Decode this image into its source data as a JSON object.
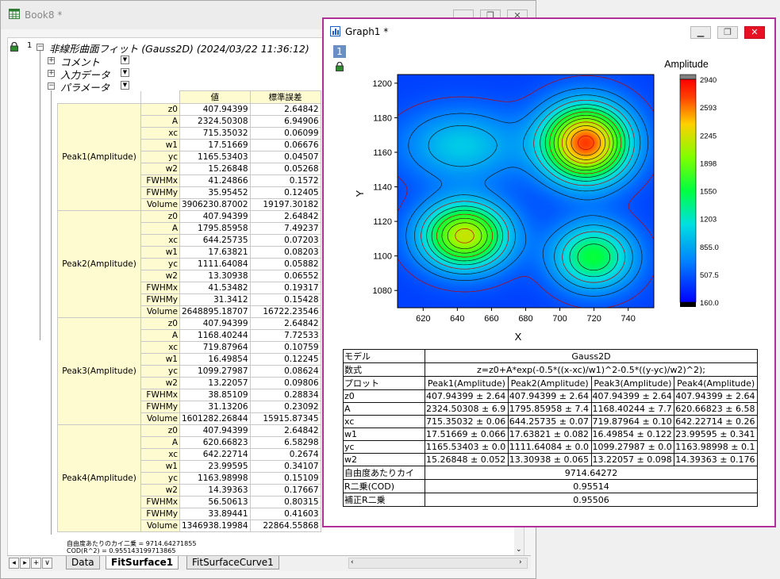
{
  "book": {
    "title": "Book8 *",
    "report_title": "非線形曲面フィット (Gauss2D) (2024/03/22 11:36:12)",
    "sections": [
      "コメント",
      "入力データ",
      "パラメータ"
    ],
    "header": {
      "value": "値",
      "error": "標準誤差"
    },
    "peaks": [
      {
        "label": "Peak1(Amplitude)",
        "rows": [
          {
            "name": "z0",
            "value": "407.94399",
            "error": "2.64842"
          },
          {
            "name": "A",
            "value": "2324.50308",
            "error": "6.94906"
          },
          {
            "name": "xc",
            "value": "715.35032",
            "error": "0.06099"
          },
          {
            "name": "w1",
            "value": "17.51669",
            "error": "0.06676"
          },
          {
            "name": "yc",
            "value": "1165.53403",
            "error": "0.04507"
          },
          {
            "name": "w2",
            "value": "15.26848",
            "error": "0.05268"
          },
          {
            "name": "FWHMx",
            "value": "41.24866",
            "error": "0.1572"
          },
          {
            "name": "FWHMy",
            "value": "35.95452",
            "error": "0.12405"
          },
          {
            "name": "Volume",
            "value": "3906230.87002",
            "error": "19197.30182"
          }
        ]
      },
      {
        "label": "Peak2(Amplitude)",
        "rows": [
          {
            "name": "z0",
            "value": "407.94399",
            "error": "2.64842"
          },
          {
            "name": "A",
            "value": "1795.85958",
            "error": "7.49237"
          },
          {
            "name": "xc",
            "value": "644.25735",
            "error": "0.07203"
          },
          {
            "name": "w1",
            "value": "17.63821",
            "error": "0.08203"
          },
          {
            "name": "yc",
            "value": "1111.64084",
            "error": "0.05882"
          },
          {
            "name": "w2",
            "value": "13.30938",
            "error": "0.06552"
          },
          {
            "name": "FWHMx",
            "value": "41.53482",
            "error": "0.19317"
          },
          {
            "name": "FWHMy",
            "value": "31.3412",
            "error": "0.15428"
          },
          {
            "name": "Volume",
            "value": "2648895.18707",
            "error": "16722.23546"
          }
        ]
      },
      {
        "label": "Peak3(Amplitude)",
        "rows": [
          {
            "name": "z0",
            "value": "407.94399",
            "error": "2.64842"
          },
          {
            "name": "A",
            "value": "1168.40244",
            "error": "7.72533"
          },
          {
            "name": "xc",
            "value": "719.87964",
            "error": "0.10759"
          },
          {
            "name": "w1",
            "value": "16.49854",
            "error": "0.12245"
          },
          {
            "name": "yc",
            "value": "1099.27987",
            "error": "0.08624"
          },
          {
            "name": "w2",
            "value": "13.22057",
            "error": "0.09806"
          },
          {
            "name": "FWHMx",
            "value": "38.85109",
            "error": "0.28834"
          },
          {
            "name": "FWHMy",
            "value": "31.13206",
            "error": "0.23092"
          },
          {
            "name": "Volume",
            "value": "1601282.26844",
            "error": "15915.87345"
          }
        ]
      },
      {
        "label": "Peak4(Amplitude)",
        "rows": [
          {
            "name": "z0",
            "value": "407.94399",
            "error": "2.64842"
          },
          {
            "name": "A",
            "value": "620.66823",
            "error": "6.58298"
          },
          {
            "name": "xc",
            "value": "642.22714",
            "error": "0.2674"
          },
          {
            "name": "w1",
            "value": "23.99595",
            "error": "0.34107"
          },
          {
            "name": "yc",
            "value": "1163.98998",
            "error": "0.15109"
          },
          {
            "name": "w2",
            "value": "14.39363",
            "error": "0.17667"
          },
          {
            "name": "FWHMx",
            "value": "56.50613",
            "error": "0.80315"
          },
          {
            "name": "FWHMy",
            "value": "33.89441",
            "error": "0.41603"
          },
          {
            "name": "Volume",
            "value": "1346938.19984",
            "error": "22864.55868"
          }
        ]
      }
    ],
    "footnote1": "自由度あたりのカイ二乗 = 9714.64271855",
    "footnote2": "COD(R^2) = 0.955143199713865",
    "tabs": [
      "Data",
      "FitSurface1",
      "FitSurfaceCurve1"
    ],
    "row_number": "1"
  },
  "graph": {
    "title": "Graph1 *",
    "layer_number": "1",
    "colorbar_title": "Amplitude",
    "colorbar_ticks": [
      "2940",
      "2593",
      "2245",
      "1898",
      "1550",
      "1203",
      "855.0",
      "507.5",
      "160.0"
    ],
    "xlabel": "X",
    "ylabel": "Y",
    "xticks": [
      "620",
      "640",
      "660",
      "680",
      "700",
      "720",
      "740"
    ],
    "yticks": [
      "1200",
      "1180",
      "1160",
      "1140",
      "1120",
      "1100",
      "1080"
    ],
    "table": {
      "model_label": "モデル",
      "model": "Gauss2D",
      "eq_label": "数式",
      "equation": "z=z0+A*exp(-0.5*((x-xc)/w1)^2-0.5*((y-yc)/w2)^2);",
      "plot_label": "プロット",
      "columns": [
        "Peak1(Amplitude)",
        "Peak2(Amplitude)",
        "Peak3(Amplitude)",
        "Peak4(Amplitude)"
      ],
      "rows": [
        {
          "name": "z0",
          "cells": [
            "407.94399 ± 2.64",
            "407.94399 ± 2.64",
            "407.94399 ± 2.64",
            "407.94399 ± 2.64"
          ]
        },
        {
          "name": "A",
          "cells": [
            "2324.50308 ± 6.9",
            "1795.85958 ± 7.4",
            "1168.40244 ± 7.7",
            "620.66823 ± 6.58"
          ]
        },
        {
          "name": "xc",
          "cells": [
            "715.35032 ± 0.06",
            "644.25735 ± 0.07",
            "719.87964 ± 0.10",
            "642.22714 ± 0.26"
          ]
        },
        {
          "name": "w1",
          "cells": [
            "17.51669 ± 0.066",
            "17.63821 ± 0.082",
            "16.49854 ± 0.122",
            "23.99595 ± 0.341"
          ]
        },
        {
          "name": "yc",
          "cells": [
            "1165.53403 ± 0.0",
            "1111.64084 ± 0.0",
            "1099.27987 ± 0.0",
            "1163.98998 ± 0.1"
          ]
        },
        {
          "name": "w2",
          "cells": [
            "15.26848 ± 0.052",
            "13.30938 ± 0.065",
            "13.22057 ± 0.098",
            "14.39363 ± 0.176"
          ]
        }
      ],
      "chi_label": "自由度あたりカイ",
      "chi": "9714.64272",
      "r2_label": "R二乗(COD)",
      "r2": "0.95514",
      "adjr2_label": "補正R二乗",
      "adjr2": "0.95506"
    }
  },
  "chart_data": {
    "type": "heatmap",
    "title": "",
    "xlabel": "X",
    "ylabel": "Y",
    "xlim": [
      605,
      755
    ],
    "ylim": [
      1070,
      1205
    ],
    "zlim": [
      160,
      2940
    ],
    "colorbar_label": "Amplitude",
    "model": "Gauss2D",
    "baseline_z0": 407.94399,
    "peaks": [
      {
        "name": "Peak1",
        "A": 2324.50308,
        "xc": 715.35032,
        "w1": 17.51669,
        "yc": 1165.53403,
        "w2": 15.26848
      },
      {
        "name": "Peak2",
        "A": 1795.85958,
        "xc": 644.25735,
        "w1": 17.63821,
        "yc": 1111.64084,
        "w2": 13.30938
      },
      {
        "name": "Peak3",
        "A": 1168.40244,
        "xc": 719.87964,
        "w1": 16.49854,
        "yc": 1099.27987,
        "w2": 13.22057
      },
      {
        "name": "Peak4",
        "A": 620.66823,
        "xc": 642.22714,
        "w1": 23.99595,
        "yc": 1163.98998,
        "w2": 14.39363
      }
    ]
  }
}
